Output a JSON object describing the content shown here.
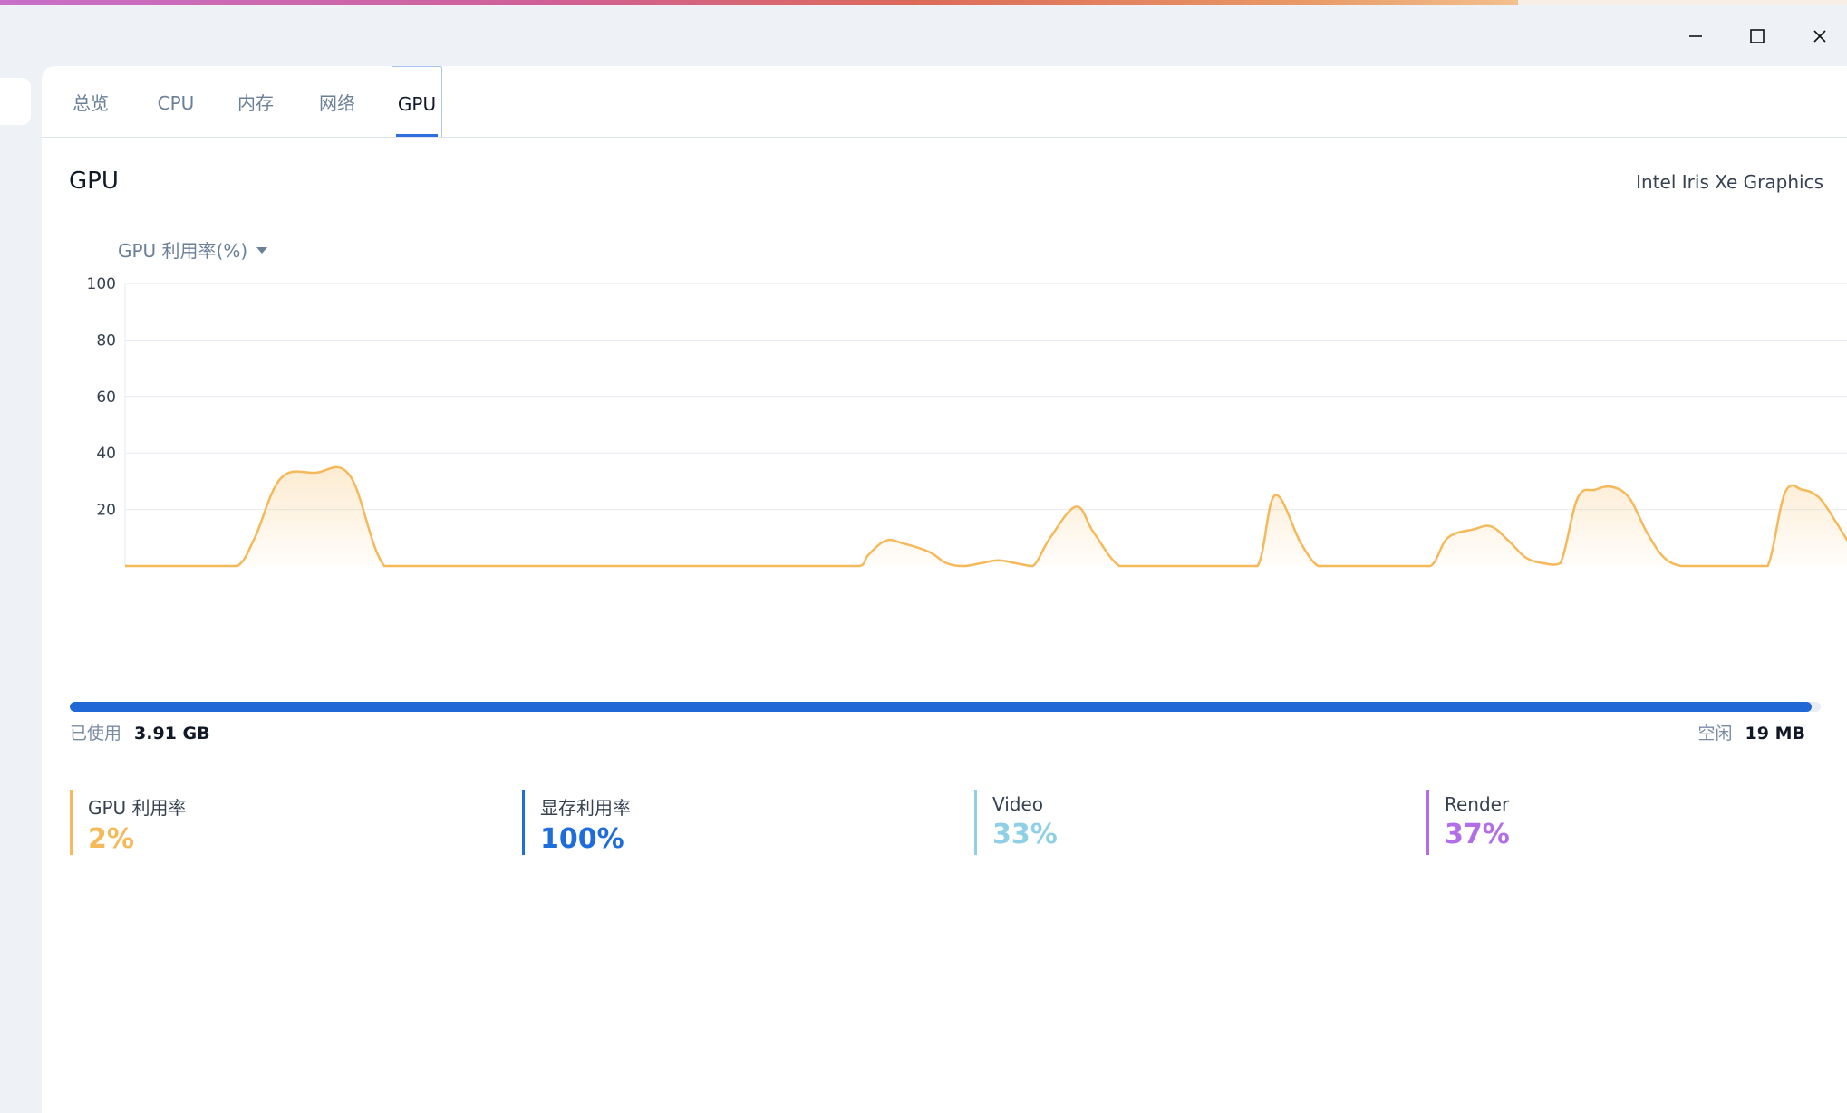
{
  "window": {
    "controls": [
      "minimize-icon",
      "maximize-icon",
      "close-icon"
    ]
  },
  "tabs": [
    {
      "label": "总览",
      "active": false
    },
    {
      "label": "CPU",
      "active": false
    },
    {
      "label": "内存",
      "active": false
    },
    {
      "label": "网络",
      "active": false
    },
    {
      "label": "GPU",
      "active": true
    }
  ],
  "section": {
    "title": "GPU",
    "device": "Intel Iris Xe Graphics",
    "metric_selector": "GPU 利用率(%)",
    "metric_selector_icon": "caret-down-icon"
  },
  "chart_data": {
    "type": "area",
    "ylim": [
      0,
      100
    ],
    "y_ticks": [
      "20",
      "40",
      "60",
      "80",
      "100"
    ],
    "grid": true,
    "series": [
      {
        "color": "#f5b95a",
        "x": [
          0,
          5,
          10,
          13,
          15,
          18,
          22,
          26,
          30,
          35,
          40,
          45,
          50,
          55,
          60,
          65,
          70,
          74,
          78,
          80,
          82,
          85,
          86,
          88,
          90,
          93,
          95,
          97,
          99,
          101,
          103,
          105,
          107,
          110,
          112,
          115,
          118,
          120,
          122,
          124,
          126,
          128,
          131,
          133,
          136,
          138,
          140,
          142,
          144,
          146,
          148,
          151,
          153,
          156,
          158,
          160,
          162,
          164,
          166,
          168,
          170,
          172,
          174,
          176,
          178,
          180,
          182,
          184,
          186,
          188,
          190,
          192,
          194,
          196,
          198,
          200
        ],
        "values": [
          0,
          0,
          0,
          0,
          10,
          31,
          33,
          32,
          0,
          0,
          0,
          0,
          0,
          0,
          0,
          0,
          0,
          0,
          0,
          0,
          0,
          0,
          4,
          9,
          8,
          5,
          1,
          0,
          1,
          2,
          1,
          0,
          10,
          21,
          12,
          0,
          0,
          0,
          0,
          0,
          0,
          0,
          0,
          25,
          8,
          0,
          0,
          0,
          0,
          0,
          0,
          0,
          10,
          13,
          14,
          9,
          3,
          1,
          1,
          24,
          27,
          28,
          24,
          12,
          3,
          0,
          0,
          0,
          0,
          0,
          0,
          26,
          27,
          24,
          15,
          5
        ]
      }
    ]
  },
  "memory": {
    "used_label": "已使用",
    "used_value": "3.91 GB",
    "free_label": "空闲",
    "free_value": "19 MB",
    "used_fraction": 0.995
  },
  "stats": [
    {
      "label": "GPU 利用率",
      "value": "2%",
      "color": "#f5b95a"
    },
    {
      "label": "显存利用率",
      "value": "100%",
      "color": "#1e6ddc"
    },
    {
      "label": "Video",
      "value": "33%",
      "color": "#8fd0e6"
    },
    {
      "label": "Render",
      "value": "37%",
      "color": "#b26ee8"
    }
  ]
}
